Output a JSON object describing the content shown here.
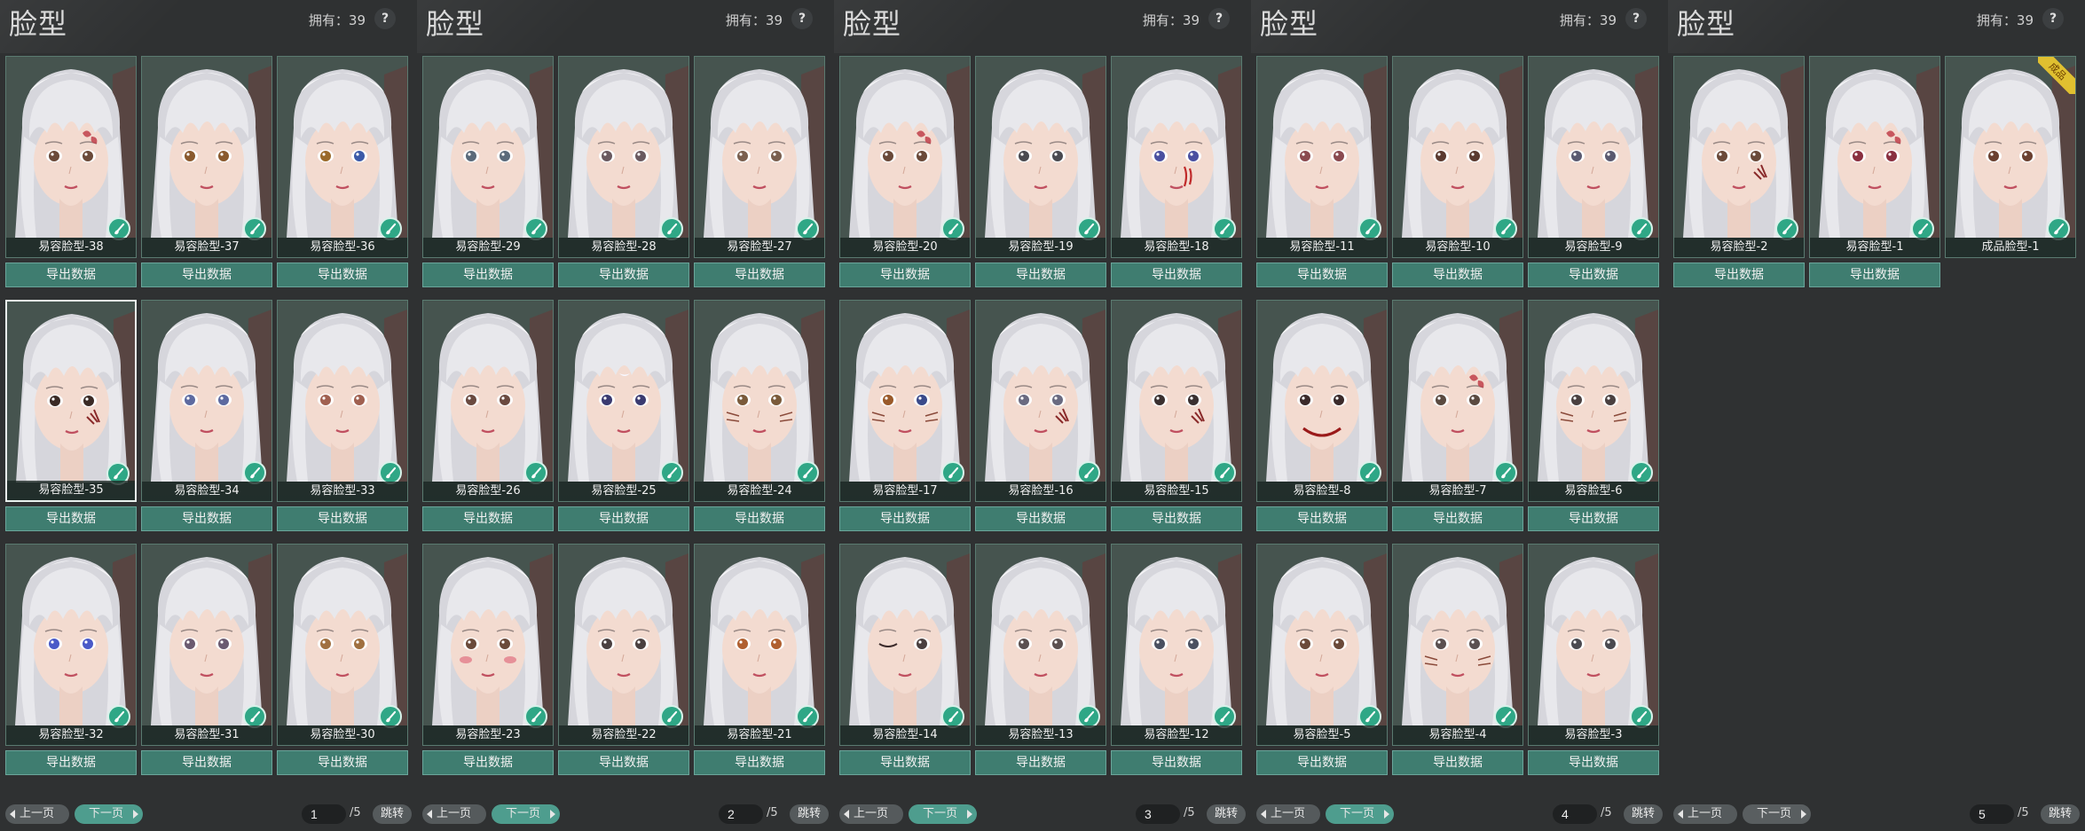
{
  "colors": {
    "background": "#2f3132",
    "card_border": "#5a7a70",
    "export_button": "#3f7d70",
    "badge": "#2fa786",
    "active_page_button": "#4e9d8e",
    "finished_ribbon": "#e0c030",
    "hair": "#e8e8ec",
    "skin": "#f3dbd0"
  },
  "icons": {
    "help": "question-mark",
    "badge": "brush-icon",
    "prev": "chevron-left-icon",
    "next": "chevron-right-icon"
  },
  "common": {
    "panel_title": "脸型",
    "owned_text": "拥有：39",
    "help_label": "?",
    "export_label": "导出数据",
    "prev_label": "上一页",
    "next_label": "下一页",
    "jump_label": "跳转",
    "page_total": "/5"
  },
  "panels": [
    {
      "page": "1",
      "active_pager_button": "next",
      "cards": [
        {
          "label": "易容脸型-38",
          "eye": "#6b4a3a",
          "mark": "flower",
          "exportable": true
        },
        {
          "label": "易容脸型-37",
          "eye": "#8a5a2e",
          "mark": "",
          "exportable": true
        },
        {
          "label": "易容脸型-36",
          "eye": "#9a6a2a",
          "eye2": "#3c5aa8",
          "mark": "",
          "exportable": true
        },
        {
          "label": "易容脸型-35",
          "eye": "#3a2a25",
          "mark": "scar",
          "exportable": true,
          "selected": true
        },
        {
          "label": "易容脸型-34",
          "eye": "#5d6aa0",
          "mark": "",
          "exportable": true
        },
        {
          "label": "易容脸型-33",
          "eye": "#a06050",
          "mark": "",
          "exportable": true
        },
        {
          "label": "易容脸型-32",
          "eye": "#4a5ac8",
          "mark": "",
          "exportable": true
        },
        {
          "label": "易容脸型-31",
          "eye": "#6a5a70",
          "mark": "",
          "exportable": true
        },
        {
          "label": "易容脸型-30",
          "eye": "#a07040",
          "mark": "",
          "exportable": true
        }
      ]
    },
    {
      "page": "2",
      "active_pager_button": "next",
      "cards": [
        {
          "label": "易容脸型-29",
          "eye": "#5a6a7a",
          "mark": "",
          "exportable": true
        },
        {
          "label": "易容脸型-28",
          "eye": "#6a5a60",
          "mark": "",
          "exportable": true
        },
        {
          "label": "易容脸型-27",
          "eye": "#7a6050",
          "mark": "",
          "exportable": true
        },
        {
          "label": "易容脸型-26",
          "eye": "#6a4a40",
          "mark": "",
          "exportable": true
        },
        {
          "label": "易容脸型-25",
          "eye": "#3a3a70",
          "mark": "moon",
          "exportable": true
        },
        {
          "label": "易容脸型-24",
          "eye": "#7a5a3a",
          "mark": "whiskers",
          "exportable": true
        },
        {
          "label": "易容脸型-23",
          "eye": "#6a4a3a",
          "mark": "blush",
          "exportable": true
        },
        {
          "label": "易容脸型-22",
          "eye": "#4a4040",
          "mark": "",
          "exportable": true
        },
        {
          "label": "易容脸型-21",
          "eye": "#b06030",
          "mark": "",
          "exportable": true
        }
      ]
    },
    {
      "page": "3",
      "active_pager_button": "next",
      "cards": [
        {
          "label": "易容脸型-20",
          "eye": "#6a4a3a",
          "mark": "flower",
          "exportable": true
        },
        {
          "label": "易容脸型-19",
          "eye": "#4a4a50",
          "mark": "",
          "exportable": true
        },
        {
          "label": "易容脸型-18",
          "eye": "#4a50a0",
          "mark": "blood",
          "exportable": true
        },
        {
          "label": "易容脸型-17",
          "eye": "#9a5a2a",
          "eye2": "#3a4a8a",
          "mark": "whiskers",
          "exportable": true
        },
        {
          "label": "易容脸型-16",
          "eye": "#6a6a80",
          "mark": "scar",
          "exportable": true
        },
        {
          "label": "易容脸型-15",
          "eye": "#3a3030",
          "mark": "scar",
          "exportable": true
        },
        {
          "label": "易容脸型-14",
          "eye": "#4a4040",
          "mark": "wink",
          "exportable": true
        },
        {
          "label": "易容脸型-13",
          "eye": "#5a5050",
          "mark": "",
          "exportable": true
        },
        {
          "label": "易容脸型-12",
          "eye": "#4a5060",
          "mark": "",
          "exportable": true
        }
      ]
    },
    {
      "page": "4",
      "active_pager_button": "next",
      "cards": [
        {
          "label": "易容脸型-11",
          "eye": "#8a4a50",
          "mark": "",
          "exportable": true
        },
        {
          "label": "易容脸型-10",
          "eye": "#5a3a30",
          "mark": "",
          "exportable": true
        },
        {
          "label": "易容脸型-9",
          "eye": "#5a5a70",
          "mark": "",
          "exportable": true
        },
        {
          "label": "易容脸型-8",
          "eye": "#3a2a2a",
          "mark": "smile",
          "exportable": true
        },
        {
          "label": "易容脸型-7",
          "eye": "#5a4a40",
          "mark": "flower",
          "exportable": true
        },
        {
          "label": "易容脸型-6",
          "eye": "#4a4040",
          "mark": "whiskers",
          "exportable": true
        },
        {
          "label": "易容脸型-5",
          "eye": "#6a4a3a",
          "mark": "",
          "exportable": true
        },
        {
          "label": "易容脸型-4",
          "eye": "#5a5050",
          "mark": "whiskers",
          "exportable": true
        },
        {
          "label": "易容脸型-3",
          "eye": "#4a4a50",
          "mark": "",
          "exportable": true
        }
      ]
    },
    {
      "page": "5",
      "active_pager_button": "none",
      "cards": [
        {
          "label": "易容脸型-2",
          "eye": "#6a4a3a",
          "mark": "scar",
          "exportable": true
        },
        {
          "label": "易容脸型-1",
          "eye": "#8a3040",
          "mark": "flower",
          "exportable": true
        },
        {
          "label": "成品脸型-1",
          "eye": "#6a4030",
          "mark": "",
          "exportable": false,
          "ribbon": "成品"
        }
      ]
    }
  ]
}
